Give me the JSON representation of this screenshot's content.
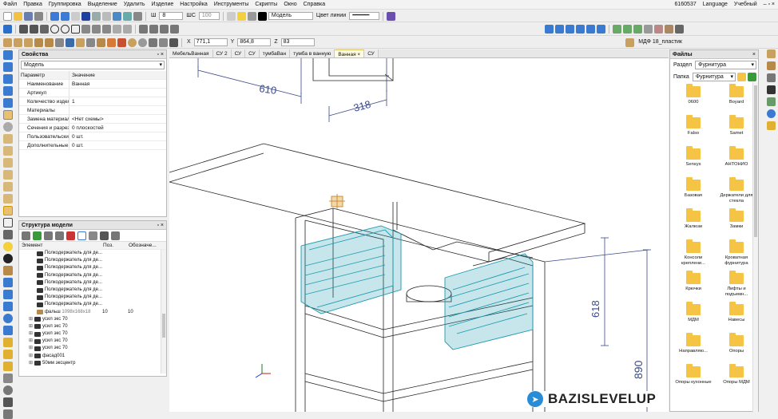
{
  "menu": {
    "items": [
      "Файл",
      "Правка",
      "Группировка",
      "Выделение",
      "Удалить",
      "Изделие",
      "Настройка",
      "Инструменты",
      "Скрипты",
      "Окно",
      "Справка"
    ],
    "right": [
      "6160537",
      "Language",
      "Учебный"
    ]
  },
  "toolbar": {
    "line_width": "8",
    "shc_label": "ШС",
    "shc_value": "100",
    "layer": "Модель",
    "line_color_label": "Цвет линии"
  },
  "toolbar3": {
    "x_label": "X",
    "x_value": "771,1",
    "y_label": "Y",
    "y_value": "864,8",
    "z_label": "Z",
    "z_value": "83",
    "material": "МДФ 18_пластик"
  },
  "properties": {
    "title": "Свойства",
    "type": "Модель",
    "header": {
      "param": "Параметр",
      "value": "Значение"
    },
    "rows": [
      {
        "k": "Наименование",
        "v": "Ванная"
      },
      {
        "k": "Артикул",
        "v": ""
      },
      {
        "k": "Количество издел",
        "v": "1"
      },
      {
        "k": "Материалы",
        "v": ""
      },
      {
        "k": "Замена материало",
        "v": "<Нет схемы>"
      },
      {
        "k": "Сечения и разрезы",
        "v": "0 плоскостей"
      },
      {
        "k": "Пользовательские",
        "v": "0 шт."
      },
      {
        "k": "Дополнительные у",
        "v": "0 шт."
      }
    ]
  },
  "structure": {
    "title": "Структура модели",
    "header": {
      "element": "Элемент",
      "pos": "Поз.",
      "desig": "Обозначе..."
    },
    "rows": [
      {
        "n": "Полкодержатель для де...",
        "p": "",
        "o": "",
        "e": ""
      },
      {
        "n": "Полкодержатель для де...",
        "p": "",
        "o": "",
        "e": ""
      },
      {
        "n": "Полкодержатель для де...",
        "p": "",
        "o": "",
        "e": ""
      },
      {
        "n": "Полкодержатель для де...",
        "p": "",
        "o": "",
        "e": ""
      },
      {
        "n": "Полкодержатель для де...",
        "p": "",
        "o": "",
        "e": ""
      },
      {
        "n": "Полкодержатель для де...",
        "p": "",
        "o": "",
        "e": ""
      },
      {
        "n": "Полкодержатель для де...",
        "p": "",
        "o": "",
        "e": ""
      },
      {
        "n": "Полкодержатель для де...",
        "p": "",
        "o": "",
        "e": ""
      },
      {
        "n": "фальш",
        "s": "1098x168x18",
        "p": "10",
        "o": "10",
        "e": ""
      },
      {
        "n": "усил экс 70",
        "p": "",
        "o": "",
        "e": "⊞"
      },
      {
        "n": "усил экс 70",
        "p": "",
        "o": "",
        "e": "⊞"
      },
      {
        "n": "усил экс 70",
        "p": "",
        "o": "",
        "e": "⊞"
      },
      {
        "n": "усил экс 70",
        "p": "",
        "o": "",
        "e": "⊞"
      },
      {
        "n": "усил экс 70",
        "p": "",
        "o": "",
        "e": "⊞"
      },
      {
        "n": "фасад001",
        "p": "",
        "o": "",
        "e": "⊞"
      },
      {
        "n": "50мм эксцентр",
        "p": "",
        "o": "",
        "e": "⊞"
      }
    ]
  },
  "tabs": [
    "МебельВанная",
    "СУ 2",
    "СУ",
    "СУ",
    "тумбаВан",
    "тумба в ванную",
    "Ванная",
    "СУ"
  ],
  "dimensions": {
    "d1": "610",
    "d2": "318",
    "d3": "618",
    "d4": "890"
  },
  "files": {
    "title": "Файлы",
    "section_label": "Раздел",
    "section": "Фурнитура",
    "folder_label": "Папка",
    "folder": "Фурнитура",
    "items": [
      "0600",
      "Boyard",
      "Falso",
      "Samet",
      "Sensys",
      "АНТОНИО",
      "Базовая",
      "Держатели для стекла",
      "Жалюзи",
      "Замки",
      "Консоли креплени...",
      "Кроватная фурнитура",
      "Крючки",
      "Лифты и подъемн...",
      "МДМ",
      "Навесы",
      "Направляю...",
      "Опоры",
      "Опоры кухонные",
      "Опоры МДМ"
    ]
  },
  "brand": {
    "text": "BAZISLEVELUP"
  }
}
